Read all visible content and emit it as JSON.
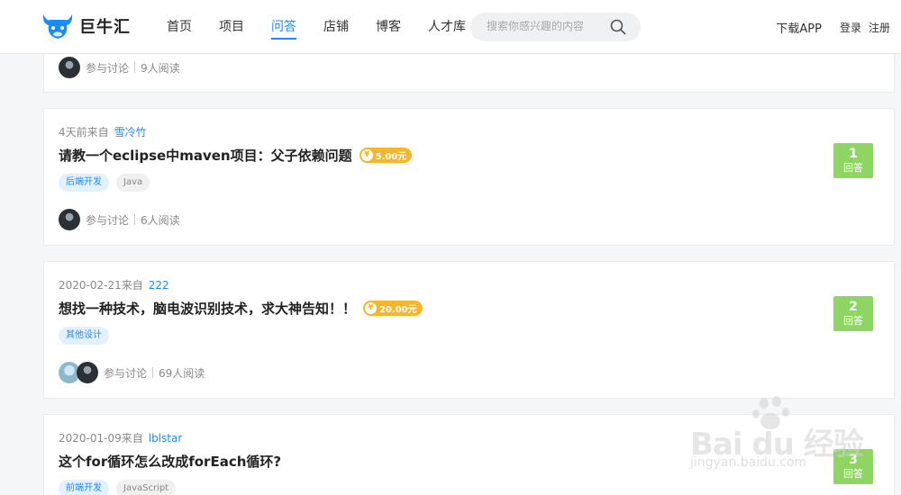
{
  "header": {
    "logo_text": "巨牛汇",
    "nav": [
      {
        "label": "首页",
        "active": false
      },
      {
        "label": "项目",
        "active": false
      },
      {
        "label": "问答",
        "active": true
      },
      {
        "label": "店铺",
        "active": false
      },
      {
        "label": "博客",
        "active": false
      },
      {
        "label": "人才库",
        "active": false
      }
    ],
    "search_placeholder": "搜索你感兴趣的内容",
    "download_label": "下载APP",
    "login_label": "登录",
    "register_label": "注册"
  },
  "colors": {
    "accent": "#1b8bf5",
    "answers_bg": "#8ed564",
    "reward_bg": "#f7b52c"
  },
  "posts": [
    {
      "discuss_label": "参与讨论",
      "reads": "9人阅读"
    },
    {
      "time": "4天前来自",
      "author": "雪冷竹",
      "title": "请教一个eclipse中maven项目：父子依赖问题",
      "reward": "5.00元",
      "tags": [
        "后端开发",
        "Java"
      ],
      "discuss_label": "参与讨论",
      "reads": "6人阅读",
      "answer_count": "1",
      "answer_label": "回答"
    },
    {
      "time": "2020-02-21来自",
      "author": "222",
      "title": "想找一种技术，脑电波识别技术，求大神告知！！",
      "reward": "20.00元",
      "tags": [
        "其他设计"
      ],
      "discuss_label": "参与讨论",
      "reads": "69人阅读",
      "answer_count": "2",
      "answer_label": "回答"
    },
    {
      "time": "2020-01-09来自",
      "author": "lblstar",
      "title": "这个for循环怎么改成forEach循环?",
      "tags": [
        "前端开发",
        "JavaScript"
      ],
      "answer_count": "3",
      "answer_label": "回答"
    }
  ],
  "watermark": {
    "text": "Bai du 经验",
    "url": "jingyan.baidu.com"
  }
}
